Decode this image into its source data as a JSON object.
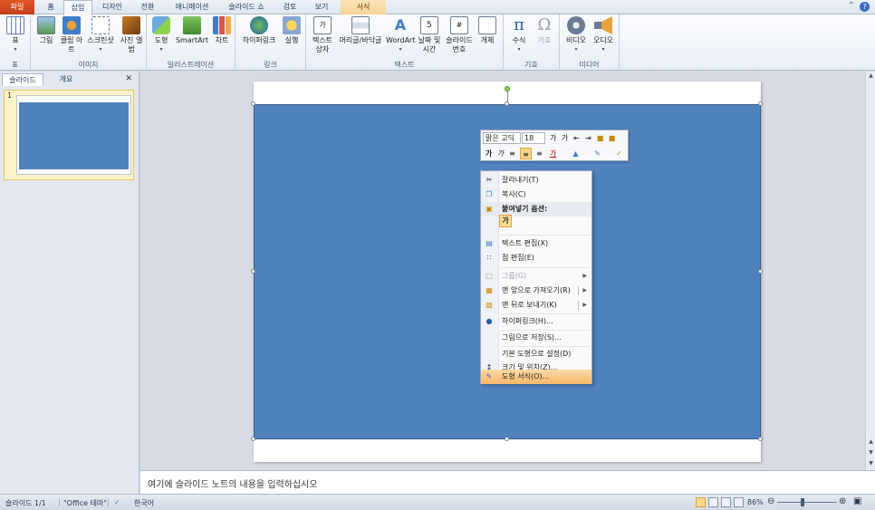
{
  "ribbon_tabs": [
    "파일",
    "홈",
    "삽입",
    "디자인",
    "전환",
    "애니메이션",
    "슬라이드 쇼",
    "검토",
    "보기",
    "서식"
  ],
  "ribbon_groups": [
    {
      "label": "표",
      "buttons": [
        "표"
      ]
    },
    {
      "label": "이미지",
      "buttons": [
        "그림",
        "클립 아트",
        "스크린샷",
        "사진 앨범"
      ]
    },
    {
      "label": "일러스트레이션",
      "buttons": [
        "도형",
        "SmartArt",
        "차트"
      ]
    },
    {
      "label": "링크",
      "buttons": [
        "하이퍼링크",
        "실행"
      ]
    },
    {
      "label": "텍스트",
      "buttons": [
        "텍스트 상자",
        "머리글/바닥글",
        "WordArt",
        "날짜 및 시간",
        "슬라이드 번호",
        "개체"
      ]
    },
    {
      "label": "기호",
      "buttons": [
        "수식",
        "기호"
      ]
    },
    {
      "label": "미디어",
      "buttons": [
        "비디오",
        "오디오"
      ]
    }
  ],
  "left_pane": {
    "tabs": [
      "슬라이드",
      "개요"
    ],
    "slide_number": "1"
  },
  "mini_toolbar": {
    "font": "맑은 고딕",
    "size": "18"
  },
  "context_menu": [
    {
      "label": "잘라내기(T)",
      "icon": "scissors-icon"
    },
    {
      "label": "복사(C)",
      "icon": "copy-icon"
    },
    {
      "label": "붙여넣기 옵션:",
      "icon": "paste-icon",
      "header": true
    },
    {
      "label": "가",
      "icon": "keep-text-icon"
    },
    {
      "label": "텍스트 편집(X)",
      "icon": "edit-text-icon"
    },
    {
      "label": "점 편집(E)",
      "icon": "edit-points-icon"
    },
    {
      "label": "그룹(G)",
      "icon": "group-icon",
      "disabled": true,
      "submenu": true
    },
    {
      "label": "맨 앞으로 가져오기(R)",
      "icon": "bring-front-icon",
      "submenu": true
    },
    {
      "label": "맨 뒤로 보내기(K)",
      "icon": "send-back-icon",
      "submenu": true
    },
    {
      "label": "하이퍼링크(H)...",
      "icon": "hyperlink-icon"
    },
    {
      "label": "그림으로 저장(S)...",
      "icon": ""
    },
    {
      "label": "기본 도형으로 설정(D)",
      "icon": ""
    },
    {
      "label": "크기 및 위치(Z)...",
      "icon": "size-position-icon"
    },
    {
      "label": "도형 서식(O)...",
      "icon": "format-shape-icon",
      "highlighted": true
    }
  ],
  "notes_placeholder": "여기에 슬라이드 노트의 내용을 입력하십시오",
  "status": {
    "slide": "슬라이드 1/1",
    "theme": "\"Office 테마\"",
    "language": "한국어",
    "zoom": "86%"
  },
  "colors": {
    "shape_fill": "#4f81bd",
    "file_tab": "#d14a1f",
    "highlight": "#f7b76a"
  }
}
